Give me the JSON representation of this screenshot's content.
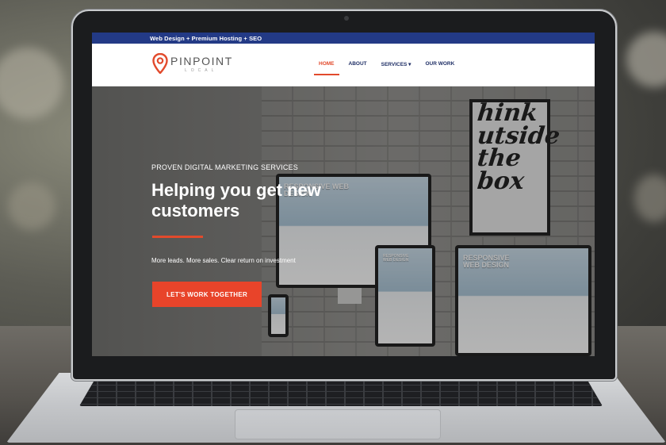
{
  "topbar": {
    "text": "Web Design + Premium Hosting + SEO"
  },
  "logo": {
    "name": "PINPOINT",
    "tagline": "LOCAL"
  },
  "nav": {
    "items": [
      {
        "label": "HOME",
        "active": true
      },
      {
        "label": "ABOUT"
      },
      {
        "label": "SERVICES ▾"
      },
      {
        "label": "OUR WORK"
      }
    ]
  },
  "hero": {
    "eyebrow": "PROVEN DIGITAL MARKETING SERVICES",
    "headline_line1": "Helping you get new",
    "headline_line2": "customers",
    "subtext": "More leads. More sales. Clear return on investment",
    "cta_label": "LET'S WORK TOGETHER",
    "poster": [
      "hink",
      "utside",
      "the",
      "box"
    ],
    "device_text": "RESPONSIVE WEB DESIGN"
  },
  "colors": {
    "accent": "#e24a2c",
    "topbar": "#233a86",
    "nav_text": "#1f2f66"
  }
}
